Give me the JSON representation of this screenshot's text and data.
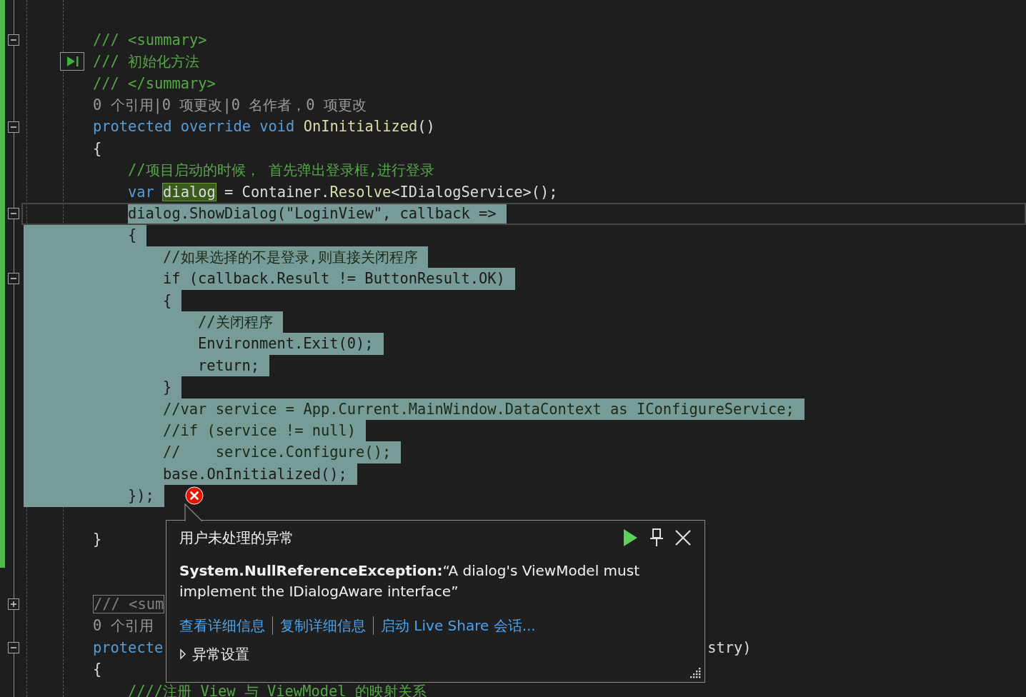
{
  "editor": {
    "lines": [
      {
        "expanded": true,
        "selected": false,
        "tokens": [
          {
            "text": "/// <summary>",
            "kind": "doc"
          }
        ]
      },
      {
        "run_to_click": true,
        "selected": false,
        "tokens": [
          {
            "text": "/// 初始化方法",
            "kind": "doc"
          }
        ]
      },
      {
        "selected": false,
        "tokens": [
          {
            "text": "/// </summary>",
            "kind": "doc"
          }
        ]
      },
      {
        "selected": false,
        "tokens": [
          {
            "text": "0 个引用|0 项更改|0 名作者，0 项更改",
            "kind": "lens"
          }
        ]
      },
      {
        "expanded": true,
        "selected": false,
        "tokens": [
          {
            "text": "protected override void ",
            "kind": "keyword"
          },
          {
            "text": "OnInitialized",
            "kind": "method"
          },
          {
            "text": "()",
            "kind": "plain"
          }
        ]
      },
      {
        "selected": false,
        "tokens": [
          {
            "text": "{",
            "kind": "plain"
          }
        ],
        "children": [
          {
            "selected": false,
            "tokens": [
              {
                "text": "//项目启动的时候， 首先弹出登录框,进行登录",
                "kind": "comment"
              }
            ]
          },
          {
            "selected": false,
            "tokens": [
              {
                "text": "var ",
                "kind": "keyword"
              },
              {
                "text": "dialog",
                "kind": "ref"
              },
              {
                "text": " = Container.",
                "kind": "plain"
              },
              {
                "text": "Resolve",
                "kind": "method"
              },
              {
                "text": "<IDialogService>();",
                "kind": "plain"
              }
            ]
          },
          {
            "current": true,
            "expanded": true,
            "selected": true,
            "tokens": [
              {
                "text": "dialog.ShowDialog(\"LoginView\", callback =>",
                "kind": "plain"
              }
            ]
          },
          {
            "selected": true,
            "tokens": [
              {
                "text": "{",
                "kind": "plain"
              }
            ],
            "children": [
              {
                "selected": true,
                "tokens": [
                  {
                    "text": "//如果选择的不是登录,则直接关闭程序",
                    "kind": "comment"
                  }
                ]
              },
              {
                "expanded": true,
                "selected": true,
                "tokens": [
                  {
                    "text": "if (callback.Result != ButtonResult.OK)",
                    "kind": "plain"
                  }
                ]
              },
              {
                "selected": true,
                "tokens": [
                  {
                    "text": "{",
                    "kind": "plain"
                  }
                ],
                "children": [
                  {
                    "selected": true,
                    "tokens": [
                      {
                        "text": "//关闭程序",
                        "kind": "comment"
                      }
                    ]
                  },
                  {
                    "selected": true,
                    "tokens": [
                      {
                        "text": "Environment.Exit(0);",
                        "kind": "plain"
                      }
                    ]
                  },
                  {
                    "selected": true,
                    "tokens": [
                      {
                        "text": "return;",
                        "kind": "plain"
                      }
                    ]
                  }
                ]
              },
              {
                "selected": true,
                "tokens": [
                  {
                    "text": "}",
                    "kind": "plain"
                  }
                ]
              },
              {
                "selected": true,
                "tokens": [
                  {
                    "text": "//var service = App.Current.MainWindow.DataContext as IConfigureService;",
                    "kind": "comment"
                  }
                ]
              },
              {
                "selected": true,
                "tokens": [
                  {
                    "text": "//if (service != null)",
                    "kind": "comment"
                  }
                ]
              },
              {
                "selected": true,
                "tokens": [
                  {
                    "text": "//    service.Configure();",
                    "kind": "comment"
                  }
                ]
              },
              {
                "selected": true,
                "tokens": [
                  {
                    "text": "base.OnInitialized();",
                    "kind": "plain"
                  }
                ]
              }
            ]
          },
          {
            "selected": true,
            "error": true,
            "tokens": [
              {
                "text": "});",
                "kind": "plain"
              }
            ]
          }
        ]
      },
      {
        "kind": "blank"
      },
      {
        "selected": false,
        "tokens": [
          {
            "text": "}",
            "kind": "plain"
          }
        ]
      },
      {
        "kind": "blank"
      },
      {
        "kind": "blank"
      },
      {
        "expanded": false,
        "selected": false,
        "tokens": [
          {
            "text": "/// <sum",
            "kind": "collapsed"
          }
        ]
      },
      {
        "selected": false,
        "tokens": [
          {
            "text": "0 个引用",
            "kind": "lens"
          }
        ]
      },
      {
        "expanded": true,
        "selected": false,
        "tokens": [
          {
            "text": "protecte",
            "kind": "keyword"
          },
          {
            "text": "stry)",
            "kind": "tail"
          }
        ]
      },
      {
        "selected": false,
        "tokens": [
          {
            "text": "{",
            "kind": "plain"
          }
        ],
        "children": [
          {
            "selected": false,
            "tokens": [
              {
                "text": "////注册 View 与 ViewModel 的映射关系",
                "kind": "comment"
              }
            ]
          }
        ]
      }
    ]
  },
  "exception_popup": {
    "title": "用户未处理的异常",
    "message": "**System.NullReferenceException:**“A dialog's ViewModel must implement the IDialogAware interface”",
    "links": [
      "查看详细信息",
      "复制详细信息",
      "启动 Live Share 会话..."
    ],
    "expander": {
      "label": "异常设置",
      "expanded": false
    }
  }
}
